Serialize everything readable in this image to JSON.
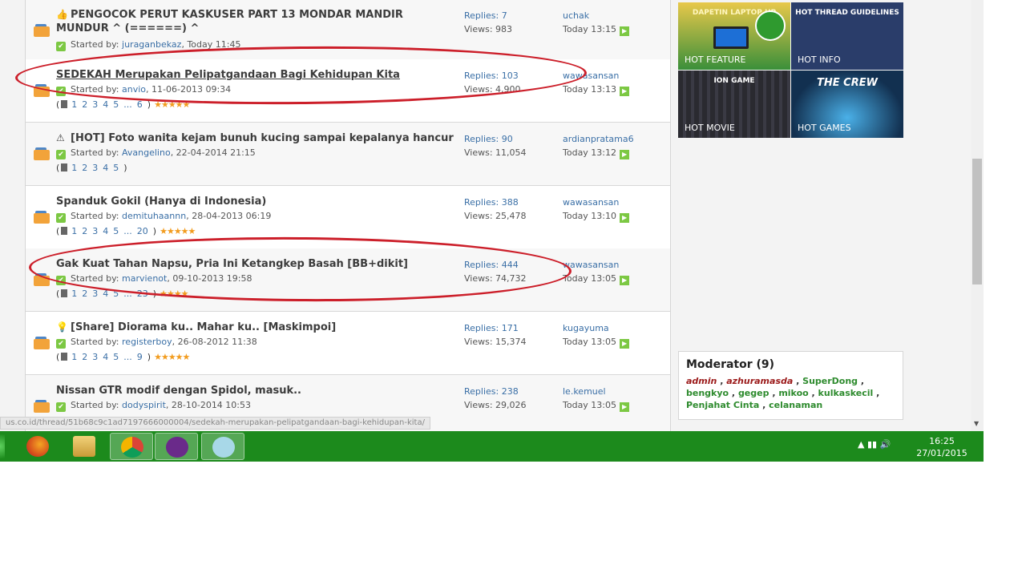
{
  "threads": [
    {
      "title": "PENGOCOK PERUT KASKUSER PART 13 MONDAR MANDIR MUNDUR ^ (======) ^",
      "icon": "thumbs-up-icon",
      "started_label": "Started by:",
      "author": "juraganbekaz",
      "date": ", Today 11:45",
      "replies": "Replies: 7",
      "views": "Views: 983",
      "last_user": "uchak",
      "last_time": "Today 13:15",
      "pages": [],
      "stars": ""
    },
    {
      "title": "SEDEKAH Merupakan Pelipatgandaan Bagi Kehidupan Kita",
      "icon": "",
      "started_label": "Started by:",
      "author": "anvio",
      "date": ", 11-06-2013 09:34",
      "replies": "Replies: 103",
      "views": "Views: 4,900",
      "last_user": "wawasansan",
      "last_time": "Today 13:13",
      "pages": [
        "1",
        "2",
        "3",
        "4",
        "5",
        "...",
        "6"
      ],
      "stars": "★★★★★"
    },
    {
      "title": "[HOT] Foto wanita kejam bunuh kucing sampai kepalanya hancur",
      "icon": "warning-icon",
      "started_label": "Started by:",
      "author": "Avangelino",
      "date": ", 22-04-2014 21:15",
      "replies": "Replies: 90",
      "views": "Views: 11,054",
      "last_user": "ardianpratama6",
      "last_time": "Today 13:12",
      "pages": [
        "1",
        "2",
        "3",
        "4",
        "5"
      ],
      "stars": ""
    },
    {
      "title": "Spanduk Gokil (Hanya di Indonesia)",
      "icon": "",
      "started_label": "Started by:",
      "author": "demituhaannn",
      "date": ", 28-04-2013 06:19",
      "replies": "Replies: 388",
      "views": "Views: 25,478",
      "last_user": "wawasansan",
      "last_time": "Today 13:10",
      "pages": [
        "1",
        "2",
        "3",
        "4",
        "5",
        "...",
        "20"
      ],
      "stars": "★★★★★"
    },
    {
      "title": "Gak Kuat Tahan Napsu, Pria Ini Ketangkep Basah [BB+dikit]",
      "icon": "",
      "started_label": "Started by:",
      "author": "marvienot",
      "date": ", 09-10-2013 19:58",
      "replies": "Replies: 444",
      "views": "Views: 74,732",
      "last_user": "wawasansan",
      "last_time": "Today 13:05",
      "pages": [
        "1",
        "2",
        "3",
        "4",
        "5",
        "...",
        "23"
      ],
      "stars": "★★★★"
    },
    {
      "title": "[Share] Diorama ku.. Mahar ku.. [Maskimpoi]",
      "icon": "bulb-icon",
      "started_label": "Started by:",
      "author": "registerboy",
      "date": ", 26-08-2012 11:38",
      "replies": "Replies: 171",
      "views": "Views: 15,374",
      "last_user": "kugayuma",
      "last_time": "Today 13:05",
      "pages": [
        "1",
        "2",
        "3",
        "4",
        "5",
        "...",
        "9"
      ],
      "stars": "★★★★★"
    },
    {
      "title": "Nissan GTR modif dengan Spidol, masuk..",
      "icon": "",
      "started_label": "Started by:",
      "author": "dodyspirit",
      "date": ", 28-10-2014 10:53",
      "replies": "Replies: 238",
      "views": "Views: 29,026",
      "last_user": "le.kemuel",
      "last_time": "Today 13:05",
      "pages": [],
      "stars": ""
    }
  ],
  "hot_tiles": [
    {
      "label": "HOT FEATURE",
      "caption_top": "DAPETIN LAPTOP HP",
      "color": "#3a8f3a"
    },
    {
      "label": "HOT INFO",
      "caption_top": "HOT THREAD GUIDELINES",
      "color": "#2a3d6a"
    },
    {
      "label": "HOT MOVIE",
      "caption_top": "ION GAME",
      "color": "#2d2d33"
    },
    {
      "label": "HOT GAMES",
      "caption_top": "THE CREW",
      "color": "#1d3c5c"
    }
  ],
  "moderator": {
    "title": "Moderator (9)",
    "names": [
      {
        "name": "admin",
        "style": "red"
      },
      {
        "name": "azhuramasda",
        "style": "red"
      },
      {
        "name": "SuperDong",
        "style": "green"
      },
      {
        "name": "bengkyo",
        "style": "green"
      },
      {
        "name": "gegep",
        "style": "green"
      },
      {
        "name": "mikoo",
        "style": "green"
      },
      {
        "name": "kulkaskecil",
        "style": "green"
      },
      {
        "name": "Penjahat Cinta",
        "style": "green"
      },
      {
        "name": "celanaman",
        "style": "green"
      }
    ]
  },
  "status_url": "us.co.id/thread/51b68c9c1ad7197666000004/sedekah-merupakan-pelipatgandaan-bagi-kehidupan-kita/",
  "taskbar": {
    "apps": [
      {
        "name": "firefox-icon",
        "color": "#e06a1a"
      },
      {
        "name": "file-explorer-icon",
        "color": "#e6c05a"
      },
      {
        "name": "chrome-icon",
        "color": "#d9a52a"
      },
      {
        "name": "yahoo-messenger-icon",
        "color": "#6a2a8a"
      },
      {
        "name": "paint-icon",
        "color": "#a8d8e8"
      }
    ],
    "tray": "▲  ▮▮  🔊",
    "time": "16:25",
    "date": "27/01/2015"
  },
  "colors": {
    "accent_red": "#cc1f2a",
    "link": "#3a6fa6",
    "taskbar": "#1c8a1c"
  }
}
